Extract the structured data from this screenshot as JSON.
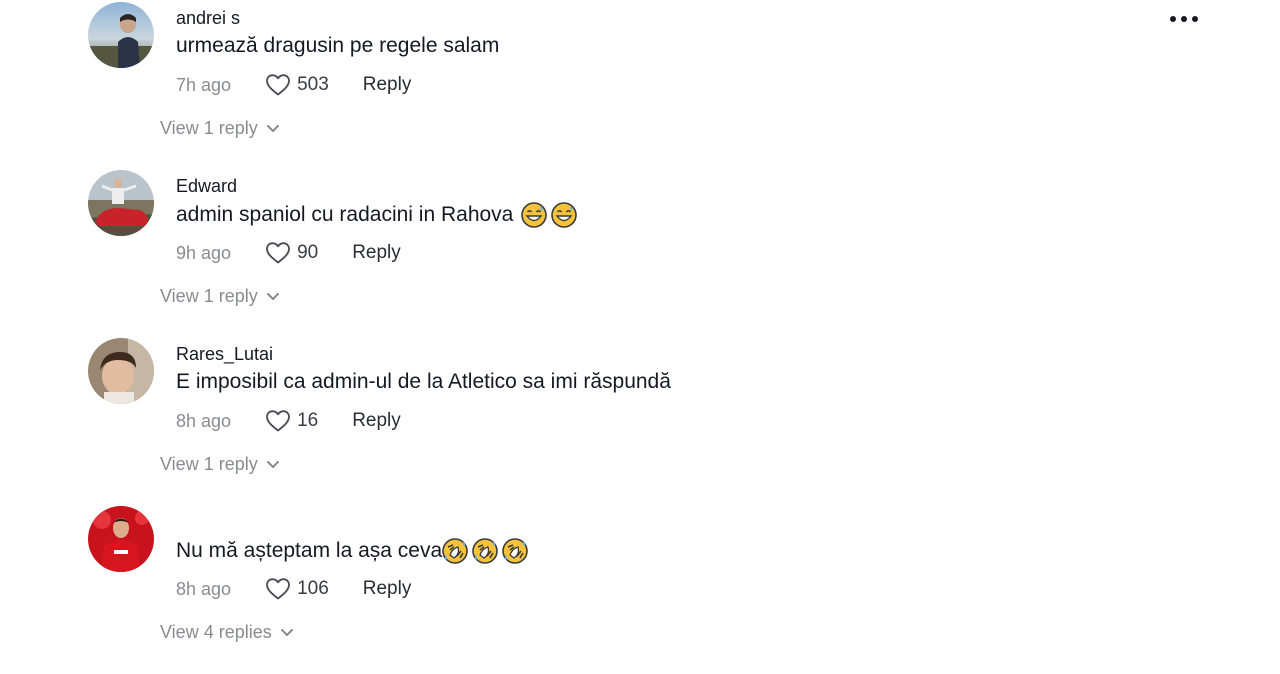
{
  "more_icon": "more-horizontal-icon",
  "colors": {
    "text_primary": "#161823",
    "text_secondary": "#8a8b91"
  },
  "comments": [
    {
      "username": "andrei s",
      "text": "urmează dragusin pe regele salam",
      "emojis": [],
      "time": "7h ago",
      "likes": "503",
      "reply_label": "Reply",
      "view_replies": "View 1 reply"
    },
    {
      "username": "Edward",
      "text": "admin spaniol cu radacini in Rahova ",
      "emojis": [
        "grinning-sweat-emoji",
        "grinning-sweat-emoji"
      ],
      "time": "9h ago",
      "likes": "90",
      "reply_label": "Reply",
      "view_replies": "View 1 reply"
    },
    {
      "username": "Rares_Lutai",
      "text": "E imposibil ca admin-ul de la Atletico sa imi răspundă",
      "emojis": [],
      "time": "8h ago",
      "likes": "16",
      "reply_label": "Reply",
      "view_replies": "View 1 reply"
    },
    {
      "username": "",
      "text": "Nu mă așteptam la așa ceva",
      "emojis": [
        "rofl-emoji",
        "rofl-emoji",
        "rofl-emoji"
      ],
      "time": "8h ago",
      "likes": "106",
      "reply_label": "Reply",
      "view_replies": "View 4 replies"
    }
  ]
}
